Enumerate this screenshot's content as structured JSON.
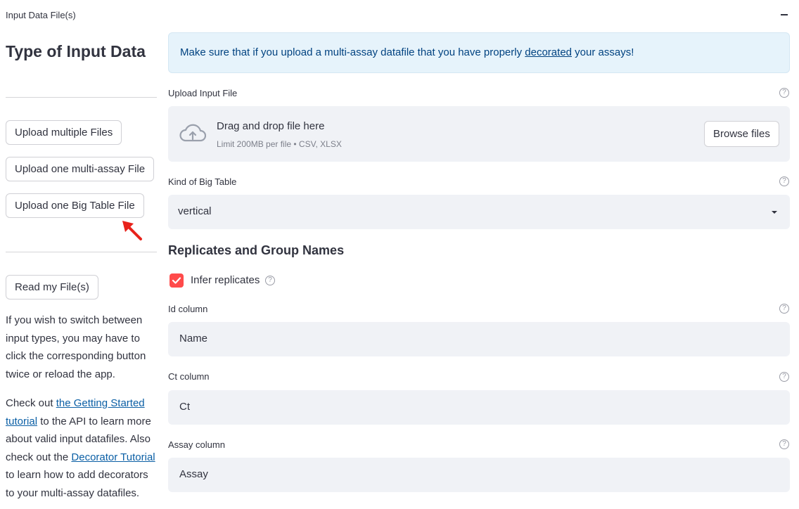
{
  "expander": {
    "title": "Input Data File(s)"
  },
  "sidebar": {
    "heading": "Type of Input Data",
    "buttons": [
      "Upload multiple Files",
      "Upload one multi-assay File",
      "Upload one Big Table File"
    ],
    "read_button": "Read my File(s)",
    "paragraph1": "If you wish to switch between input types, you may have to click the corresponding button twice or reload the app.",
    "paragraph2": {
      "p1": "Check out ",
      "link1": "the Getting Started tutorial",
      "p2": " to the API to learn more about valid input datafiles. Also check out the ",
      "link2": "Decorator Tutorial",
      "p3": " to learn how to add decorators to your multi-assay datafiles."
    }
  },
  "info": {
    "before": "Make sure that if you upload a multi-assay datafile that you have properly ",
    "link": "decorated",
    "after": " your assays!"
  },
  "upload": {
    "label": "Upload Input File",
    "dz_title": "Drag and drop file here",
    "dz_sub": "Limit 200MB per file • CSV, XLSX",
    "browse": "Browse files"
  },
  "big_table": {
    "label": "Kind of Big Table",
    "value": "vertical"
  },
  "replicates": {
    "heading": "Replicates and Group Names",
    "infer_label": "Infer replicates",
    "infer_checked": true
  },
  "id_column": {
    "label": "Id column",
    "value": "Name"
  },
  "ct_column": {
    "label": "Ct column",
    "value": "Ct"
  },
  "assay_column": {
    "label": "Assay column",
    "value": "Assay"
  },
  "help_glyph": "?",
  "colors": {
    "accent": "#ff4b4b",
    "arrow": "#e8221b",
    "info_bg": "#e6f3fb",
    "link": "#0b5fa5"
  }
}
